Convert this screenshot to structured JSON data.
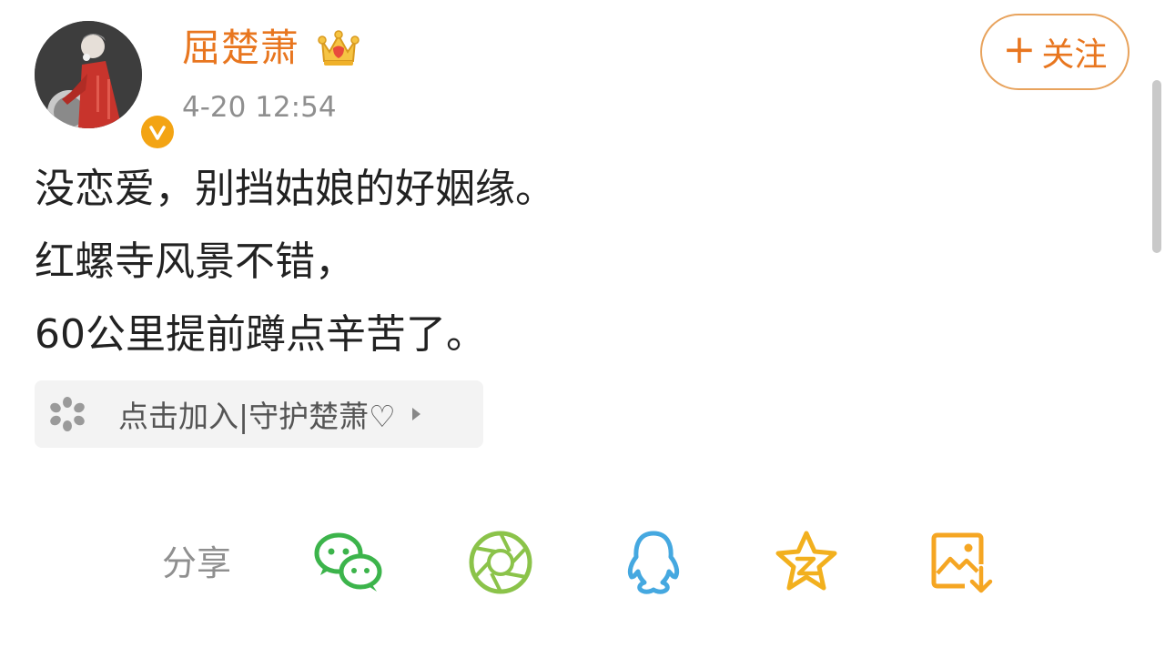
{
  "post": {
    "username": "屈楚萧",
    "timestamp": "4-20 12:54",
    "follow_label": "关注",
    "follow_plus": "+",
    "lines": [
      "没恋爱，别挡姑娘的好姻缘。",
      "红螺寺风景不错，",
      "60公里提前蹲点辛苦了。"
    ]
  },
  "super_topic": {
    "label": "点击加入|守护楚萧♡"
  },
  "share": {
    "label": "分享",
    "targets": [
      "wechat-icon",
      "moments-icon",
      "qq-icon",
      "qzone-icon",
      "save-image-icon"
    ]
  },
  "colors": {
    "accent": "#e8761f",
    "follow_border": "#e8a35d",
    "wechat": "#3cb44b",
    "moments": "#8bc34a",
    "qq": "#45a8e0",
    "qzone": "#f2b01e",
    "save": "#f5a623"
  }
}
